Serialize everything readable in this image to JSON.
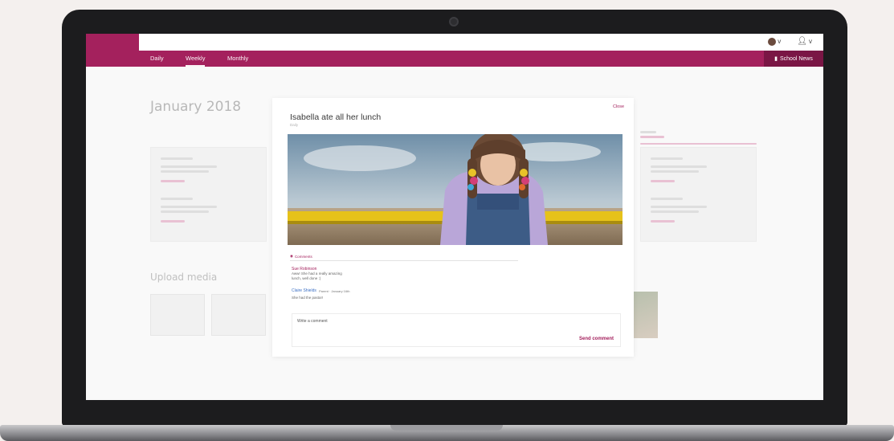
{
  "header": {
    "tabs": [
      {
        "label": "Daily",
        "active": false
      },
      {
        "label": "Weekly",
        "active": true
      },
      {
        "label": "Monthly",
        "active": false
      }
    ],
    "news_button": "School News",
    "user_caret": "v",
    "account_caret": "v"
  },
  "background": {
    "month_title": "January 2018",
    "upload_title": "Upload media"
  },
  "modal": {
    "close_label": "Close",
    "title": "Isabella ate all her lunch",
    "subtitle": "Daily",
    "comments_label": "Comments",
    "comments": [
      {
        "author": "Sue Robinson",
        "lines": [
          "Aww! She had a really amazing",
          "lunch, well done :)"
        ]
      },
      {
        "author": "Claire Shields",
        "meta": "Parent · January 16th",
        "lines": [
          "She had the pasta!!"
        ]
      }
    ],
    "comment_placeholder": "Write a comment",
    "send_label": "Send comment"
  },
  "colors": {
    "brand": "#a4215d",
    "brand_dark": "#7a1645",
    "link_blue": "#3b6fc4"
  }
}
